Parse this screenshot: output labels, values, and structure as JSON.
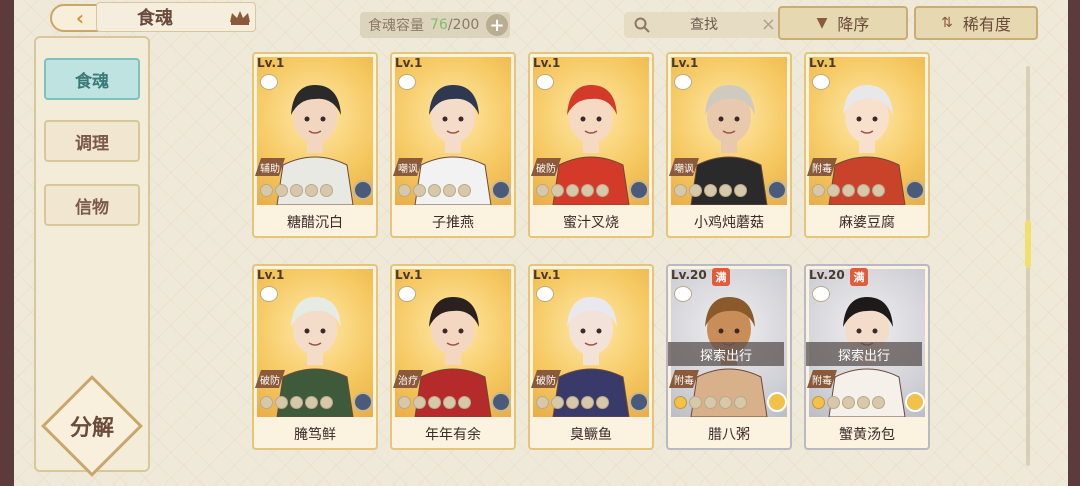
{
  "header": {
    "title": "食魂",
    "capacity_label": "食魂容量",
    "capacity_current": "76",
    "capacity_total": "/200",
    "search_placeholder": "查找",
    "sort_order_label": "降序",
    "sort_key_label": "稀有度"
  },
  "sidebar": {
    "tabs": [
      {
        "label": "食魂",
        "active": true
      },
      {
        "label": "调理",
        "active": false
      },
      {
        "label": "信物",
        "active": false
      }
    ],
    "decompose_label": "分解"
  },
  "cards": [
    {
      "level": "Lv.1",
      "name": "糖醋沉白",
      "role": "辅助",
      "stars": 0,
      "frame": "gold",
      "explore": "",
      "maxed": false
    },
    {
      "level": "Lv.1",
      "name": "子推燕",
      "role": "嘲讽",
      "stars": 0,
      "frame": "gold",
      "explore": "",
      "maxed": false
    },
    {
      "level": "Lv.1",
      "name": "蜜汁叉烧",
      "role": "破防",
      "stars": 0,
      "frame": "gold",
      "explore": "",
      "maxed": false
    },
    {
      "level": "Lv.1",
      "name": "小鸡炖蘑菇",
      "role": "嘲讽",
      "stars": 0,
      "frame": "gold",
      "explore": "",
      "maxed": false
    },
    {
      "level": "Lv.1",
      "name": "麻婆豆腐",
      "role": "附毒",
      "stars": 0,
      "frame": "gold",
      "explore": "",
      "maxed": false
    },
    {
      "level": "Lv.1",
      "name": "腌笃鲜",
      "role": "破防",
      "stars": 0,
      "frame": "gold",
      "explore": "",
      "maxed": false
    },
    {
      "level": "Lv.1",
      "name": "年年有余",
      "role": "治疗",
      "stars": 0,
      "frame": "gold",
      "explore": "",
      "maxed": false
    },
    {
      "level": "Lv.1",
      "name": "臭鳜鱼",
      "role": "破防",
      "stars": 0,
      "frame": "gold",
      "explore": "",
      "maxed": false
    },
    {
      "level": "Lv.20",
      "name": "腊八粥",
      "role": "附毒",
      "stars": 1,
      "frame": "grey",
      "explore": "探索出行",
      "maxed": true,
      "badge": "满"
    },
    {
      "level": "Lv.20",
      "name": "蟹黄汤包",
      "role": "附毒",
      "stars": 1,
      "frame": "grey",
      "explore": "探索出行",
      "maxed": true,
      "badge": "满"
    }
  ],
  "colors": {
    "background": "#efe9d9",
    "frame": "#5b3b3b",
    "gold_border": "#e6c57a",
    "active_tab": "#bfe3e0"
  }
}
